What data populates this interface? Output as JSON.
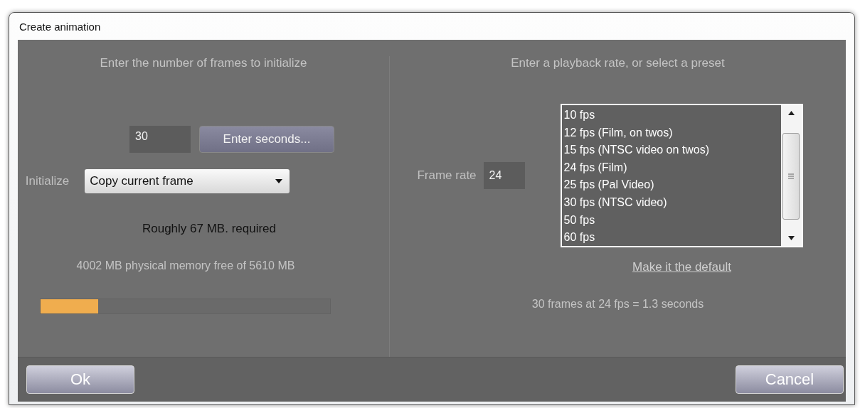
{
  "window": {
    "title": "Create animation"
  },
  "frames": {
    "heading": "Enter the number of frames to initialize",
    "count": "30",
    "seconds_button": "Enter seconds...",
    "initialize_label": "Initialize",
    "initialize_value": "Copy current frame",
    "required": "Roughly 67 MB. required",
    "memory": "4002 MB physical memory free of 5610 MB",
    "memory_bar": {
      "level": 0.2
    }
  },
  "playback": {
    "heading": "Enter a playback rate, or select a preset",
    "frame_rate_label": "Frame rate",
    "frame_rate": "24",
    "presets": [
      "10 fps",
      "12 fps (Film, on twos)",
      "15 fps (NTSC video on twos)",
      "24 fps (Film)",
      "25 fps (Pal Video)",
      "30 fps (NTSC video)",
      "50 fps",
      "60 fps"
    ],
    "default_link": "Make it the default",
    "summary": "30 frames at 24 fps = 1.3 seconds"
  },
  "buttons": [
    "Ok",
    "Cancel"
  ]
}
